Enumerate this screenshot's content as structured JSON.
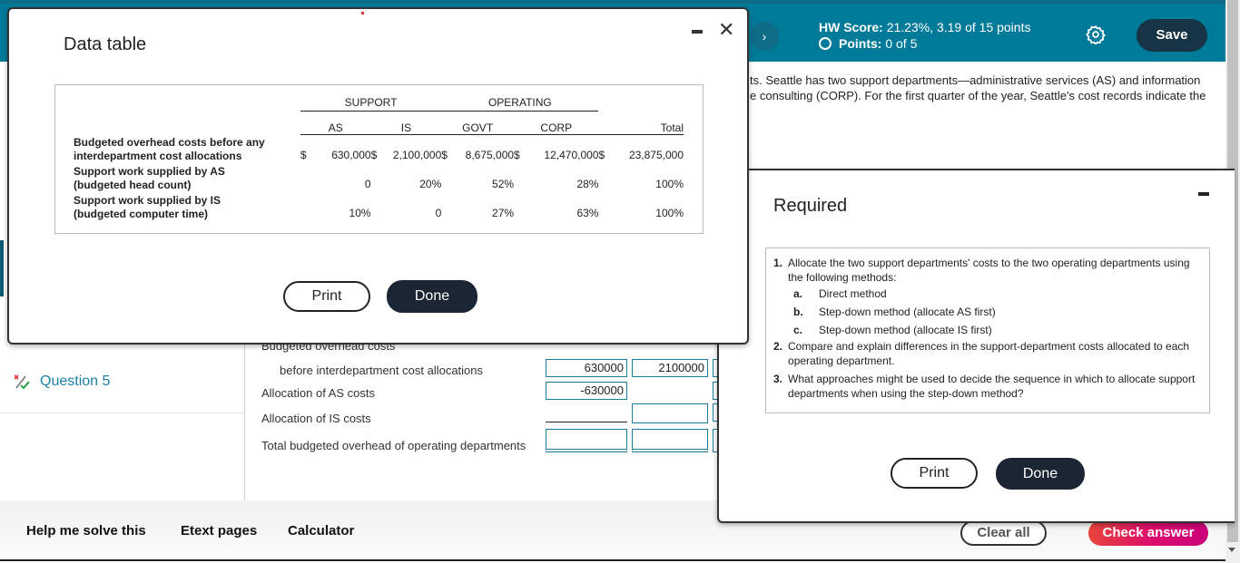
{
  "header": {
    "hw_score_label": "HW Score:",
    "hw_score_value": "21.23%, 3.19 of 15 points",
    "points_label": "Points:",
    "points_value": "0 of 5",
    "save": "Save",
    "nav_icon": "chevron-right-icon",
    "settings_icon": "gear-icon"
  },
  "background_text": [
    "ts. Seattle has two support departments—administrative services (AS) and information",
    "e consulting (CORP). For the first quarter of the year, Seattle's cost records indicate the"
  ],
  "sidebar": {
    "question": "Question 5",
    "question_icon": "partial-credit-icon"
  },
  "worksheet": {
    "rows": [
      {
        "label": "Budgeted overhead costs"
      },
      {
        "label": "before interdepartment cost allocations",
        "values": [
          "630000",
          "2100000"
        ]
      },
      {
        "label": "Allocation of AS costs",
        "values": [
          "-630000",
          ""
        ]
      },
      {
        "label": "Allocation of IS costs"
      },
      {
        "label": "Total budgeted overhead of operating departments"
      }
    ]
  },
  "bottom": {
    "help": "Help me solve this",
    "etext": "Etext pages",
    "calculator": "Calculator",
    "clear_all": "Clear all",
    "check_answer": "Check answer"
  },
  "data_table_modal": {
    "title": "Data table",
    "group_headers": [
      "SUPPORT",
      "OPERATING"
    ],
    "columns": [
      "AS",
      "IS",
      "GOVT",
      "CORP",
      "Total"
    ],
    "rows": [
      {
        "label_lines": [
          "Budgeted overhead costs before any",
          "interdepartment cost allocations"
        ],
        "cells": [
          "$",
          "630,000",
          "$",
          "2,100,000",
          "$",
          "8,675,000",
          "$",
          "12,470,000",
          "$",
          "23,875,000"
        ]
      },
      {
        "label_lines": [
          "Support work supplied by AS",
          "(budgeted head count)"
        ],
        "cells": [
          "",
          "0",
          "",
          "20%",
          "",
          "52%",
          "",
          "28%",
          "",
          "100%"
        ]
      },
      {
        "label_lines": [
          "Support work supplied by IS",
          "(budgeted computer time)"
        ],
        "cells": [
          "",
          "10%",
          "",
          "0",
          "",
          "27%",
          "",
          "63%",
          "",
          "100%"
        ]
      }
    ],
    "print": "Print",
    "done": "Done"
  },
  "required_modal": {
    "title": "Required",
    "items": [
      {
        "num": "1.",
        "text": "Allocate the two support departments' costs to the two operating departments using the following methods:",
        "sub": [
          {
            "letter": "a.",
            "text": "Direct method"
          },
          {
            "letter": "b.",
            "text": "Step-down method (allocate AS first)"
          },
          {
            "letter": "c.",
            "text": "Step-down method (allocate IS first)"
          }
        ]
      },
      {
        "num": "2.",
        "text": "Compare and explain differences in the support-department costs allocated to each operating department."
      },
      {
        "num": "3.",
        "text": "What approaches might be used to decide the sequence in which to allocate support departments when using the step-down method?"
      }
    ],
    "print": "Print",
    "done": "Done"
  }
}
